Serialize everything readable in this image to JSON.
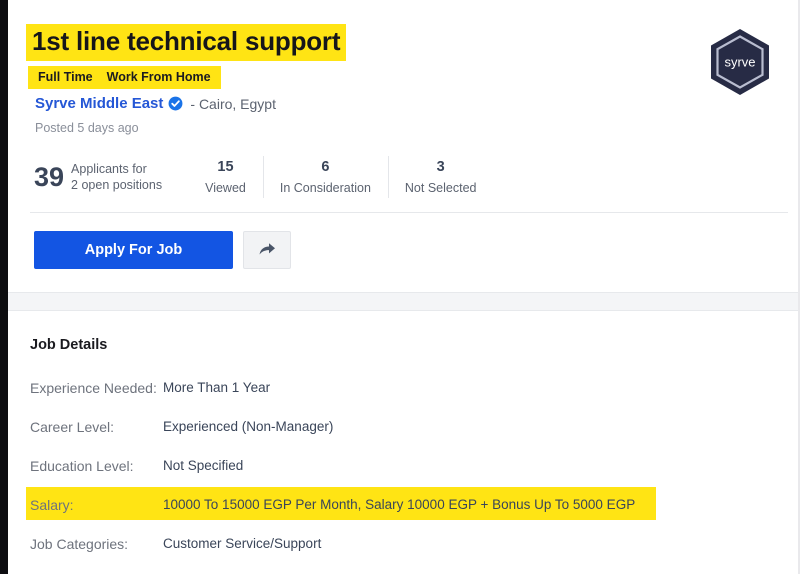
{
  "job": {
    "title": "1st line technical support",
    "tags": [
      "Full Time",
      "Work From Home"
    ],
    "company": "Syrve Middle East",
    "verified_icon": "verified-badge-icon",
    "location": "- Cairo, Egypt",
    "posted": "Posted 5 days ago"
  },
  "logo": {
    "text": "syrve",
    "shape": "hexagon",
    "fill": "#272b45",
    "ring": "#b9bdd0"
  },
  "stats": {
    "applicants_count": "39",
    "applicants_line1": "Applicants for",
    "applicants_line2": "2 open positions",
    "items": [
      {
        "value": "15",
        "label": "Viewed"
      },
      {
        "value": "6",
        "label": "In Consideration"
      },
      {
        "value": "3",
        "label": "Not Selected"
      }
    ]
  },
  "actions": {
    "apply_label": "Apply For Job",
    "share_icon": "share-arrow-icon"
  },
  "details": {
    "heading": "Job Details",
    "rows": [
      {
        "label": "Experience Needed:",
        "value": "More Than 1 Year",
        "highlight": false,
        "highlight_width": 0
      },
      {
        "label": "Career Level:",
        "value": "Experienced (Non-Manager)",
        "highlight": false,
        "highlight_width": 0
      },
      {
        "label": "Education Level:",
        "value": "Not Specified",
        "highlight": false,
        "highlight_width": 0
      },
      {
        "label": "Salary:",
        "value": "10000 To 15000 EGP Per Month, Salary 10000 EGP + Bonus Up To 5000 EGP",
        "highlight": true,
        "highlight_width": 630
      },
      {
        "label": "Job Categories:",
        "value": "Customer Service/Support",
        "highlight": false,
        "highlight_width": 0
      }
    ]
  },
  "colors": {
    "highlight_yellow": "#ffe414",
    "primary_blue": "#1355e3",
    "link_blue": "#2557d6",
    "logo_navy": "#272b45",
    "gutter_black": "#0d0d10"
  }
}
